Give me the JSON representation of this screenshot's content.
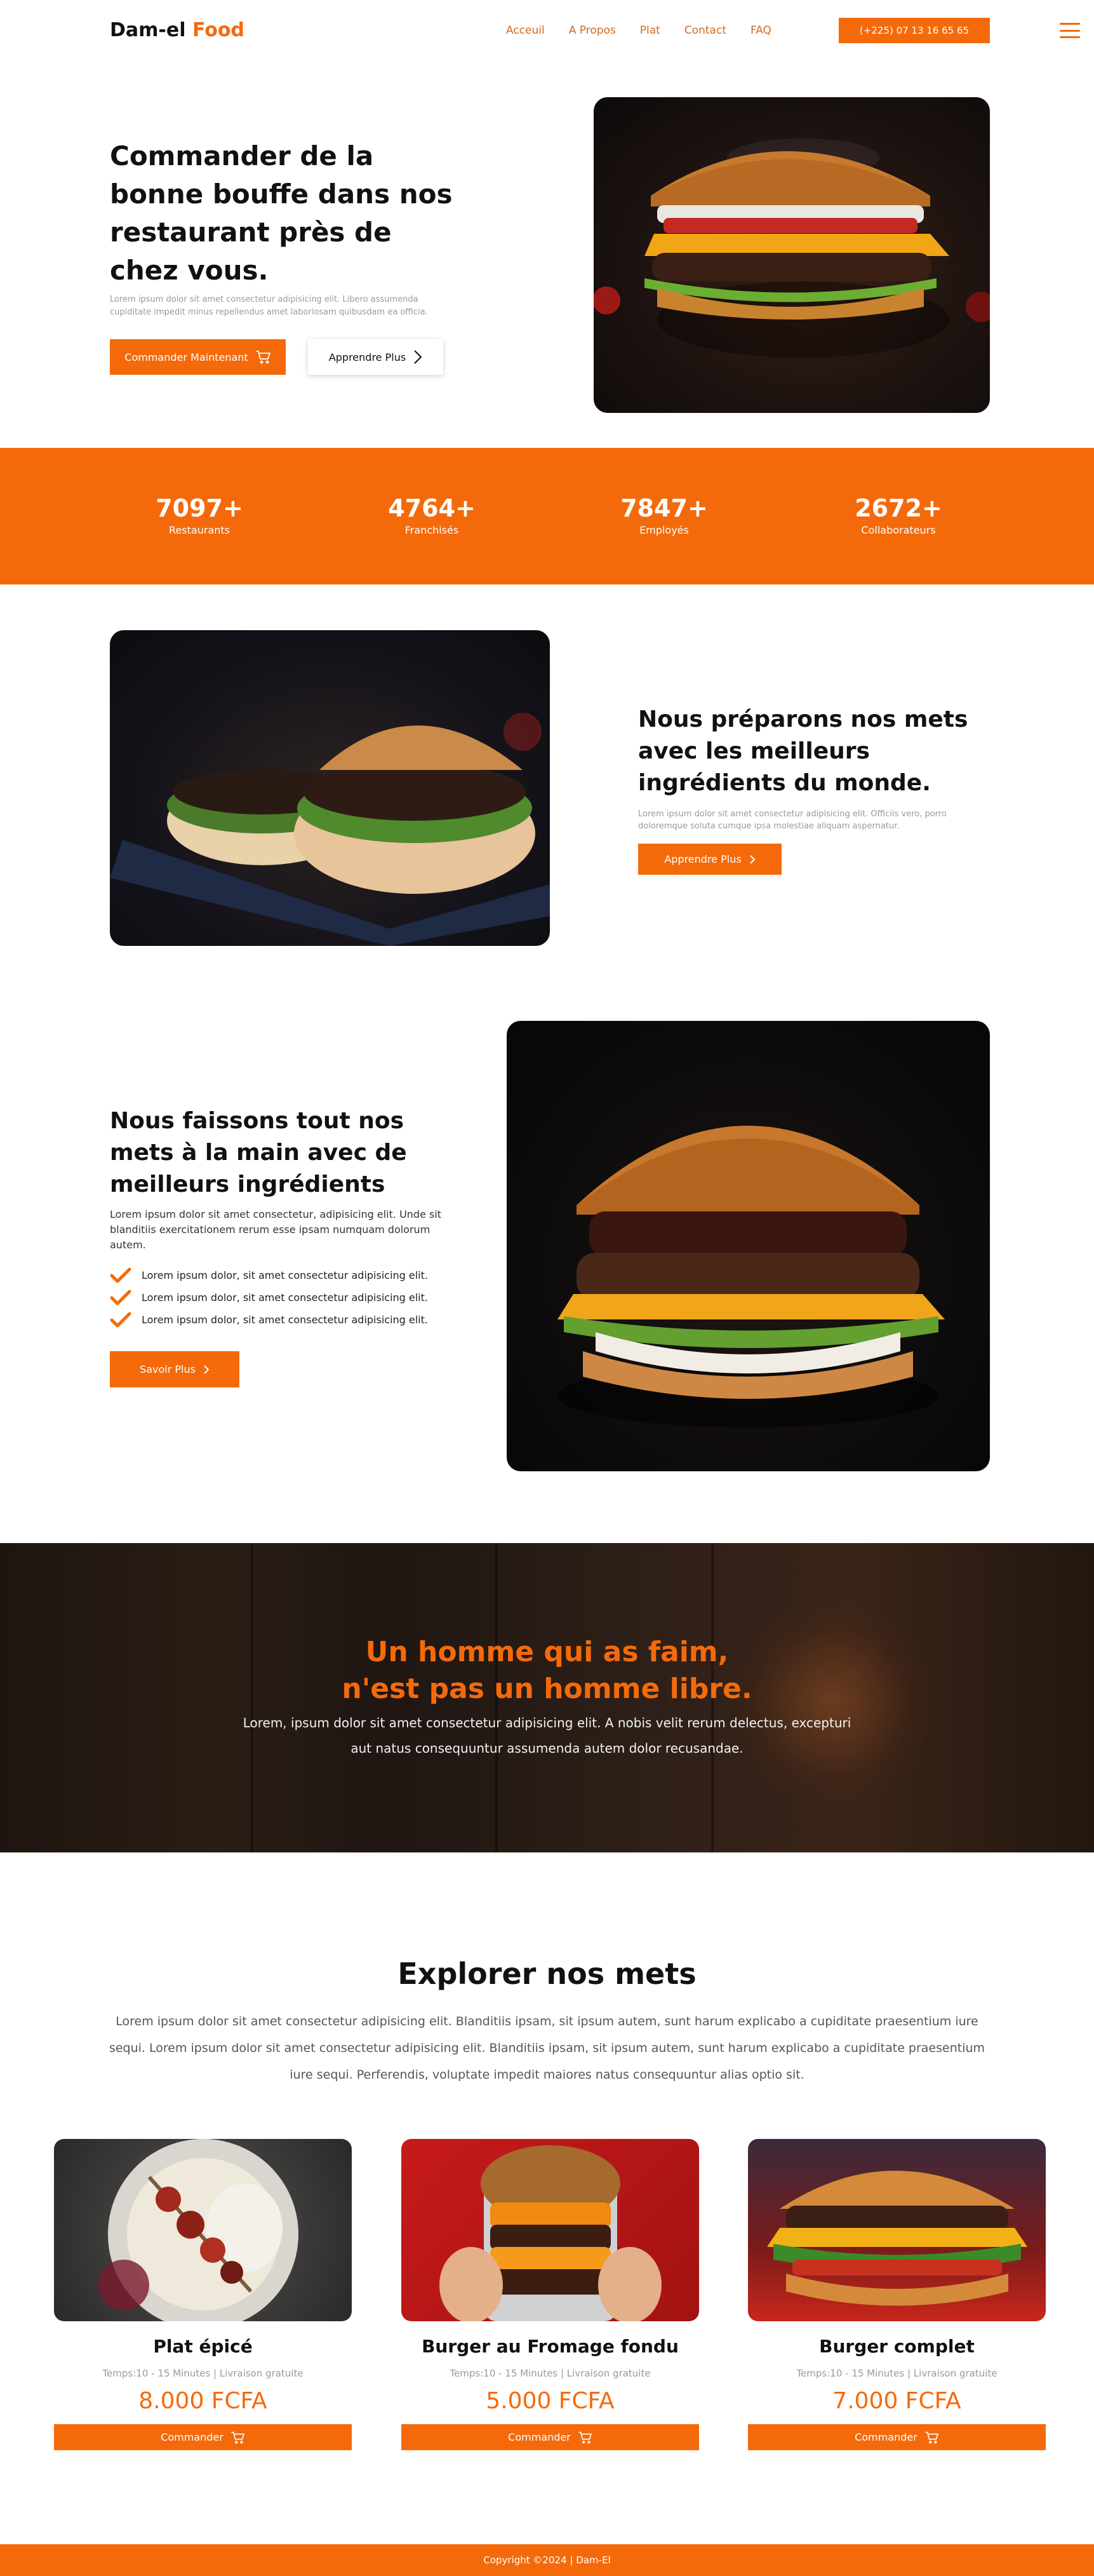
{
  "header": {
    "logo_main": "Dam-el",
    "logo_accent": "Food",
    "nav": [
      "Acceuil",
      "A Propos",
      "Plat",
      "Contact",
      "FAQ"
    ],
    "phone": "(+225) 07 13 16 65 65"
  },
  "hero": {
    "title": "Commander de la bonne bouffe dans nos restaurant près de chez vous.",
    "desc": "Lorem ipsum dolor sit amet consectetur adipisicing elit. Libero assumenda cupiditate impedit minus repellendus amet laboriosam quibusdam ea officia.",
    "btn_order": "Commander Maintenant",
    "btn_learn": "Apprendre Plus"
  },
  "stats": [
    {
      "num": "7097+",
      "label": "Restaurants"
    },
    {
      "num": "4764+",
      "label": "Franchisés"
    },
    {
      "num": "7847+",
      "label": "Employés"
    },
    {
      "num": "2672+",
      "label": "Collaborateurs"
    }
  ],
  "section3": {
    "title": "Nous préparons nos mets avec les meilleurs ingrédients du monde.",
    "desc": "Lorem ipsum dolor sit amet consectetur adipisicing elit. Officiis vero, porro doloremque soluta cumque ipsa molestiae aliquam aspernatur.",
    "btn": "Apprendre Plus"
  },
  "section4": {
    "title": "Nous faissons tout nos mets à la main avec de meilleurs ingrédients",
    "desc": "Lorem ipsum dolor sit amet consectetur, adipisicing elit. Unde sit blanditiis exercitationem rerum esse ipsam numquam dolorum autem.",
    "items": [
      "Lorem ipsum dolor, sit amet consectetur adipisicing elit.",
      "Lorem ipsum dolor, sit amet consectetur adipisicing elit.",
      "Lorem ipsum dolor, sit amet consectetur adipisicing elit."
    ],
    "btn": "Savoir Plus"
  },
  "banner": {
    "title_line1": "Un homme qui as faim,",
    "title_line2": "n'est pas un homme libre.",
    "desc": "Lorem, ipsum dolor sit amet consectetur adipisicing elit. A nobis velit rerum delectus, excepturi aut natus consequuntur assumenda autem dolor recusandae."
  },
  "explore": {
    "title": "Explorer nos mets",
    "desc": "Lorem ipsum dolor sit amet consectetur adipisicing elit. Blanditiis ipsam, sit ipsum autem, sunt harum explicabo a cupiditate praesentium iure sequi. Lorem ipsum dolor sit amet consectetur adipisicing elit. Blanditiis ipsam, sit ipsum autem, sunt harum explicabo a cupiditate praesentium iure sequi. Perferendis, voluptate impedit maiores natus consequuntur alias optio sit.",
    "cards": [
      {
        "name": "Plat épicé",
        "meta": "Temps:10 - 15 Minutes | Livraison gratuite",
        "price": "8.000 FCFA",
        "btn": "Commander"
      },
      {
        "name": "Burger au Fromage fondu",
        "meta": "Temps:10 - 15 Minutes | Livraison gratuite",
        "price": "5.000 FCFA",
        "btn": "Commander"
      },
      {
        "name": "Burger complet",
        "meta": "Temps:10 - 15 Minutes | Livraison gratuite",
        "price": "7.000 FCFA",
        "btn": "Commander"
      }
    ]
  },
  "footer": {
    "copyright": "Copyright ©2024 | Dam-El"
  },
  "colors": {
    "accent": "#f46a0b",
    "nav_link": "#d26a1c"
  },
  "icons": {
    "cart": "cart-icon",
    "chevron": "chevron-right-icon",
    "check": "check-icon",
    "menu": "hamburger-menu-icon"
  }
}
